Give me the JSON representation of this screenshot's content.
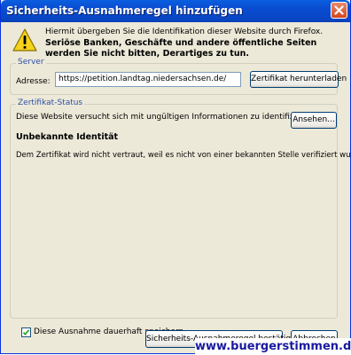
{
  "window": {
    "title": "Sicherheits-Ausnahmeregel hinzufügen"
  },
  "message": {
    "line1": "Hiermit übergeben Sie die Identifikation dieser Website durch Firefox.",
    "warning": "Seriöse Banken, Geschäfte und andere öffentliche Seiten werden Sie nicht bitten, Derartiges zu tun."
  },
  "server": {
    "legend": "Server",
    "address_label": "Adresse:",
    "address_value": "https://petition.landtag.niedersachsen.de/",
    "download_button": "Zertifikat herunterladen"
  },
  "certificate": {
    "legend": "Zertifikat-Status",
    "status_text": "Diese Website versucht sich mit ungültigen Informationen zu identifizieren.",
    "view_button": "Ansehen...",
    "identity_heading": "Unbekannte Identität",
    "trust_text": "Dem Zertifikat wird nicht vertraut, weil es nicht von einer bekannten Stelle verifiziert wurde."
  },
  "permanent": {
    "label": "Diese Ausnahme dauerhaft speichern",
    "checked": true
  },
  "buttons": {
    "confirm": "Sicherheits-Ausnahmeregel bestätigen",
    "cancel": "Abbrechen"
  },
  "watermark": "www.buergerstimmen.de",
  "colors": {
    "titlebar": "#0a4bd0",
    "dialog_bg": "#ece9d8",
    "legend": "#2f4fa8",
    "watermark": "#1a1aa0"
  },
  "icons": {
    "warning": "warning-icon",
    "close": "close-icon",
    "check": "checkmark-icon"
  }
}
